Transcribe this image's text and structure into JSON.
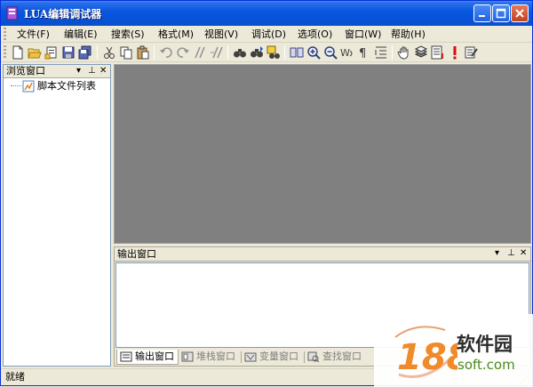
{
  "window": {
    "title": "LUA编辑调试器",
    "icon": "app-icon"
  },
  "menubar": {
    "items": [
      {
        "label": "文件(F)"
      },
      {
        "label": "编辑(E)"
      },
      {
        "label": "搜索(S)"
      },
      {
        "label": "格式(M)"
      },
      {
        "label": "视图(V)"
      },
      {
        "label": "调试(D)"
      },
      {
        "label": "选项(O)"
      },
      {
        "label": "窗口(W)"
      },
      {
        "label": "帮助(H)"
      }
    ]
  },
  "toolbar": {
    "tools": [
      "new-file-icon",
      "open-folder-icon",
      "open-recent-icon",
      "save-icon",
      "save-all-icon",
      "cut-icon",
      "copy-icon",
      "paste-icon",
      "undo-icon",
      "redo-icon",
      "comment-icon",
      "uncomment-icon",
      "find-icon",
      "find-next-icon",
      "replace-icon",
      "bookmark-icon",
      "zoom-in-icon",
      "zoom-out-icon",
      "word-wrap-icon",
      "show-whitespace-icon",
      "indent-guide-icon",
      "hand-icon",
      "stack-icon",
      "list-icon",
      "breakpoint-icon",
      "edit-icon"
    ]
  },
  "browser": {
    "title": "浏览窗口",
    "tree": [
      {
        "label": "脚本文件列表"
      }
    ]
  },
  "output": {
    "title": "输出窗口",
    "tabs": [
      {
        "label": "输出窗口",
        "active": true
      },
      {
        "label": "堆栈窗口",
        "active": false
      },
      {
        "label": "变量窗口",
        "active": false
      },
      {
        "label": "查找窗口",
        "active": false
      }
    ]
  },
  "statusbar": {
    "text": "就绪"
  },
  "watermark": {
    "number": "188",
    "cn": "软件园",
    "en": "soft.com"
  },
  "colors": {
    "titlebar": "#0a58e0",
    "editor_bg": "#808080",
    "chrome": "#ece9d8"
  }
}
